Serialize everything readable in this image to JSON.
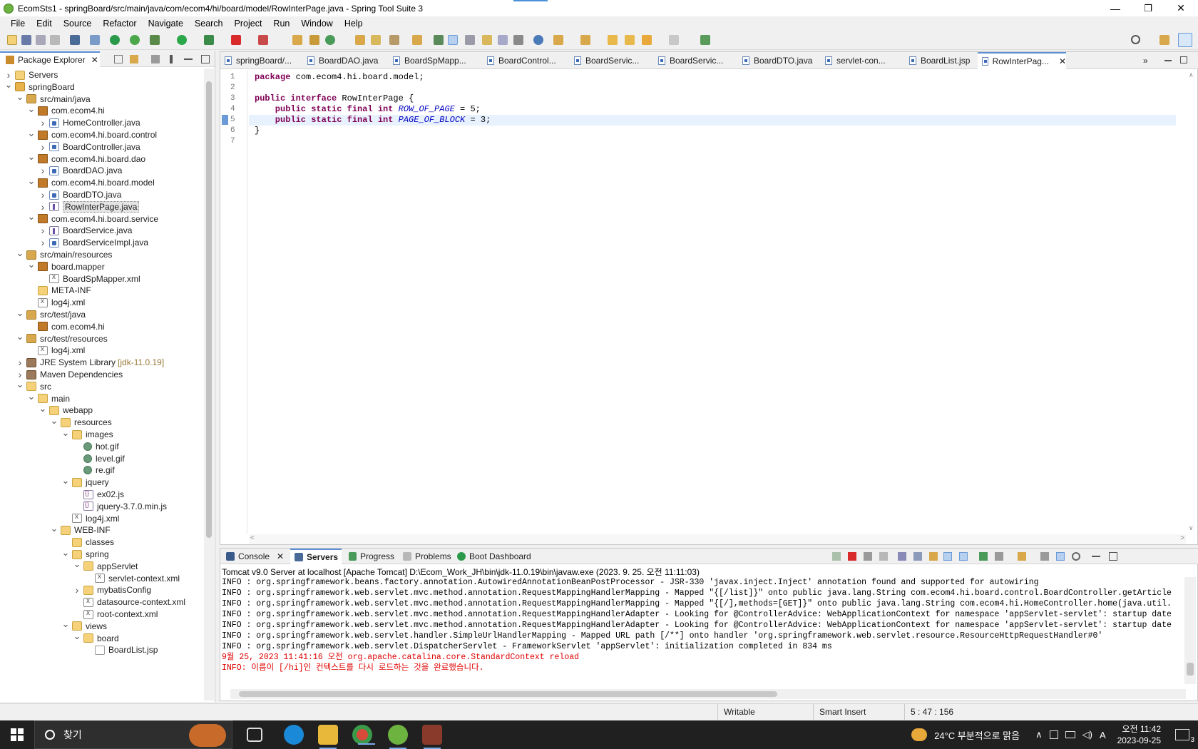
{
  "window": {
    "title": "EcomSts1 - springBoard/src/main/java/com/ecom4/hi/board/model/RowInterPage.java - Spring Tool Suite 3",
    "minimize": "—",
    "maximize": "❐",
    "close": "✕"
  },
  "menu": [
    "File",
    "Edit",
    "Source",
    "Refactor",
    "Navigate",
    "Search",
    "Project",
    "Run",
    "Window",
    "Help"
  ],
  "explorer": {
    "tab_label": "Package Explorer",
    "tree": [
      {
        "label": "Servers",
        "indent": 0,
        "chev": ">",
        "icon": "folder"
      },
      {
        "label": "springBoard",
        "indent": 0,
        "chev": "v",
        "icon": "proj"
      },
      {
        "label": "src/main/java",
        "indent": 1,
        "chev": "v",
        "icon": "srcf"
      },
      {
        "label": "com.ecom4.hi",
        "indent": 2,
        "chev": "v",
        "icon": "pkg"
      },
      {
        "label": "HomeController.java",
        "indent": 3,
        "chev": ">",
        "icon": "java"
      },
      {
        "label": "com.ecom4.hi.board.control",
        "indent": 2,
        "chev": "v",
        "icon": "pkg"
      },
      {
        "label": "BoardController.java",
        "indent": 3,
        "chev": ">",
        "icon": "java"
      },
      {
        "label": "com.ecom4.hi.board.dao",
        "indent": 2,
        "chev": "v",
        "icon": "pkg"
      },
      {
        "label": "BoardDAO.java",
        "indent": 3,
        "chev": ">",
        "icon": "java"
      },
      {
        "label": "com.ecom4.hi.board.model",
        "indent": 2,
        "chev": "v",
        "icon": "pkg"
      },
      {
        "label": "BoardDTO.java",
        "indent": 3,
        "chev": ">",
        "icon": "java"
      },
      {
        "label": "RowInterPage.java",
        "indent": 3,
        "chev": ">",
        "icon": "iface",
        "selected": true
      },
      {
        "label": "com.ecom4.hi.board.service",
        "indent": 2,
        "chev": "v",
        "icon": "pkg"
      },
      {
        "label": "BoardService.java",
        "indent": 3,
        "chev": ">",
        "icon": "iface"
      },
      {
        "label": "BoardServiceImpl.java",
        "indent": 3,
        "chev": ">",
        "icon": "java"
      },
      {
        "label": "src/main/resources",
        "indent": 1,
        "chev": "v",
        "icon": "srcf"
      },
      {
        "label": "board.mapper",
        "indent": 2,
        "chev": "v",
        "icon": "pkg"
      },
      {
        "label": "BoardSpMapper.xml",
        "indent": 3,
        "chev": "",
        "icon": "xml"
      },
      {
        "label": "META-INF",
        "indent": 2,
        "chev": "",
        "icon": "folder"
      },
      {
        "label": "log4j.xml",
        "indent": 2,
        "chev": "",
        "icon": "xml"
      },
      {
        "label": "src/test/java",
        "indent": 1,
        "chev": "v",
        "icon": "srcf"
      },
      {
        "label": "com.ecom4.hi",
        "indent": 2,
        "chev": "",
        "icon": "pkg"
      },
      {
        "label": "src/test/resources",
        "indent": 1,
        "chev": "v",
        "icon": "srcf"
      },
      {
        "label": "log4j.xml",
        "indent": 2,
        "chev": "",
        "icon": "xml"
      },
      {
        "label": "JRE System Library",
        "indent": 1,
        "chev": ">",
        "icon": "lib",
        "deco": "[jdk-11.0.19]"
      },
      {
        "label": "Maven Dependencies",
        "indent": 1,
        "chev": ">",
        "icon": "lib"
      },
      {
        "label": "src",
        "indent": 1,
        "chev": "v",
        "icon": "folder"
      },
      {
        "label": "main",
        "indent": 2,
        "chev": "v",
        "icon": "folder"
      },
      {
        "label": "webapp",
        "indent": 3,
        "chev": "v",
        "icon": "folder"
      },
      {
        "label": "resources",
        "indent": 4,
        "chev": "v",
        "icon": "folder"
      },
      {
        "label": "images",
        "indent": 5,
        "chev": "v",
        "icon": "folder"
      },
      {
        "label": "hot.gif",
        "indent": 6,
        "chev": "",
        "icon": "gif"
      },
      {
        "label": "level.gif",
        "indent": 6,
        "chev": "",
        "icon": "gif"
      },
      {
        "label": "re.gif",
        "indent": 6,
        "chev": "",
        "icon": "gif"
      },
      {
        "label": "jquery",
        "indent": 5,
        "chev": "v",
        "icon": "folder"
      },
      {
        "label": "ex02.js",
        "indent": 6,
        "chev": "",
        "icon": "js"
      },
      {
        "label": "jquery-3.7.0.min.js",
        "indent": 6,
        "chev": "",
        "icon": "js"
      },
      {
        "label": "log4j.xml",
        "indent": 5,
        "chev": "",
        "icon": "xml"
      },
      {
        "label": "WEB-INF",
        "indent": 4,
        "chev": "v",
        "icon": "folder"
      },
      {
        "label": "classes",
        "indent": 5,
        "chev": "",
        "icon": "folder"
      },
      {
        "label": "spring",
        "indent": 5,
        "chev": "v",
        "icon": "folder"
      },
      {
        "label": "appServlet",
        "indent": 6,
        "chev": "v",
        "icon": "folder"
      },
      {
        "label": "servlet-context.xml",
        "indent": 7,
        "chev": "",
        "icon": "xml"
      },
      {
        "label": "mybatisConfig",
        "indent": 6,
        "chev": ">",
        "icon": "folder"
      },
      {
        "label": "datasource-context.xml",
        "indent": 6,
        "chev": "",
        "icon": "xml"
      },
      {
        "label": "root-context.xml",
        "indent": 6,
        "chev": "",
        "icon": "xml"
      },
      {
        "label": "views",
        "indent": 5,
        "chev": "v",
        "icon": "folder"
      },
      {
        "label": "board",
        "indent": 6,
        "chev": "v",
        "icon": "folder"
      },
      {
        "label": "BoardList.jsp",
        "indent": 7,
        "chev": "",
        "icon": "jsp"
      }
    ]
  },
  "editor": {
    "tabs": [
      "springBoard/...",
      "BoardDAO.java",
      "BoardSpMapp...",
      "BoardControl...",
      "BoardServic...",
      "BoardServic...",
      "BoardDTO.java",
      "servlet-con...",
      "BoardList.jsp",
      "RowInterPag..."
    ],
    "overflow": "»",
    "line_numbers": [
      "1",
      "2",
      "3",
      "4",
      "5",
      "6",
      "7"
    ],
    "code": {
      "l1_kw": "package",
      "l1_rest": " com.ecom4.hi.board.model;",
      "l3_kw": "public interface",
      "l3_rest": " RowInterPage {",
      "l4_kw": "    public static final int",
      "l4_const": "ROW_OF_PAGE",
      "l4_rest": " = 5;",
      "l5_kw": "    public static final int",
      "l5_const": "PAGE_OF_BLOCK",
      "l5_rest": " = 3;",
      "l6": "}"
    }
  },
  "bottom": {
    "tabs": {
      "console": "Console",
      "servers": "Servers",
      "progress": "Progress",
      "problems": "Problems",
      "boot": "Boot Dashboard"
    },
    "description": "Tomcat v9.0 Server at localhost [Apache Tomcat] D:\\Ecom_Work_JH\\bin\\jdk-11.0.19\\bin\\javaw.exe  (2023. 9. 25. 오전 11:11:03)",
    "console_lines": [
      {
        "text": "INFO : org.springframework.beans.factory.annotation.AutowiredAnnotationBeanPostProcessor - JSR-330 'javax.inject.Inject' annotation found and supported for autowiring",
        "err": false
      },
      {
        "text": "INFO : org.springframework.web.servlet.mvc.method.annotation.RequestMappingHandlerMapping - Mapped \"{[/list]}\" onto public java.lang.String com.ecom4.hi.board.control.BoardController.getArticle",
        "err": false
      },
      {
        "text": "INFO : org.springframework.web.servlet.mvc.method.annotation.RequestMappingHandlerMapping - Mapped \"{[/],methods=[GET]}\" onto public java.lang.String com.ecom4.hi.HomeController.home(java.util.",
        "err": false
      },
      {
        "text": "INFO : org.springframework.web.servlet.mvc.method.annotation.RequestMappingHandlerAdapter - Looking for @ControllerAdvice: WebApplicationContext for namespace 'appServlet-servlet': startup date",
        "err": false
      },
      {
        "text": "INFO : org.springframework.web.servlet.mvc.method.annotation.RequestMappingHandlerAdapter - Looking for @ControllerAdvice: WebApplicationContext for namespace 'appServlet-servlet': startup date",
        "err": false
      },
      {
        "text": "INFO : org.springframework.web.servlet.handler.SimpleUrlHandlerMapping - Mapped URL path [/**] onto handler 'org.springframework.web.servlet.resource.ResourceHttpRequestHandler#0'",
        "err": false
      },
      {
        "text": "INFO : org.springframework.web.servlet.DispatcherServlet - FrameworkServlet 'appServlet': initialization completed in 834 ms",
        "err": false
      },
      {
        "text": "9월 25, 2023 11:41:16 오전 org.apache.catalina.core.StandardContext reload",
        "err": true
      },
      {
        "text": "INFO: 이름이 [/hi]인 컨텍스트를 다시 로드하는 것을 완료했습니다.",
        "err": true
      }
    ]
  },
  "status": {
    "writable": "Writable",
    "insert_mode": "Smart Insert",
    "position": "5 : 47 : 156"
  },
  "taskbar": {
    "search_placeholder": "찾기",
    "weather": "24°C  부분적으로 맑음",
    "time": "오전 11:42",
    "date": "2023-09-25",
    "ime": "A",
    "notification_count": "3"
  },
  "colors": {
    "keyword": "#7f0055",
    "constant": "#0000c0",
    "error": "#e00000",
    "accent": "#5c8fd6"
  }
}
